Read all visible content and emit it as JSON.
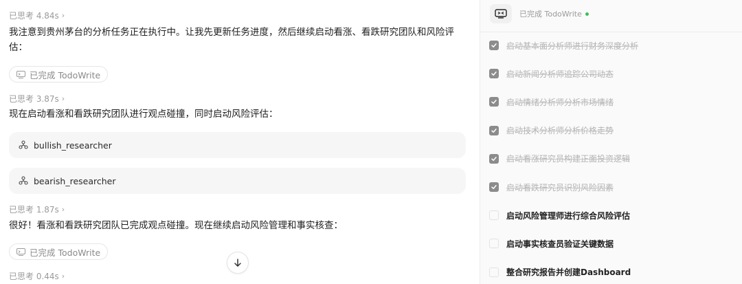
{
  "chat": {
    "think1": "已思考 4.84s",
    "msg1": "我注意到贵州茅台的分析任务正在执行中。让我先更新任务进度，然后继续启动看涨、看跌研究团队和风险评估：",
    "badge1": "已完成 TodoWrite",
    "think2": "已思考 3.87s",
    "msg2": "现在启动看涨和看跌研究团队进行观点碰撞，同时启动风险评估：",
    "tool1": "bullish_researcher",
    "tool2": "bearish_researcher",
    "think3": "已思考 1.87s",
    "msg3": "很好！看涨和看跌研究团队已完成观点碰撞。现在继续启动风险管理和事实核查：",
    "badge2": "已完成 TodoWrite",
    "think4": "已思考 0.44s"
  },
  "panel": {
    "header_label": "已完成 TodoWrite",
    "status_color": "#3cc15a",
    "todos": [
      {
        "text": "启动基本面分析师进行财务深度分析",
        "done": true
      },
      {
        "text": "启动新闻分析师追踪公司动态",
        "done": true
      },
      {
        "text": "启动情绪分析师分析市场情绪",
        "done": true
      },
      {
        "text": "启动技术分析师分析价格走势",
        "done": true
      },
      {
        "text": "启动看涨研究员构建正面投资逻辑",
        "done": true
      },
      {
        "text": "启动看跌研究员识别风险因素",
        "done": true
      },
      {
        "text": "启动风险管理师进行综合风险评估",
        "done": false
      },
      {
        "text": "启动事实核查员验证关键数据",
        "done": false
      },
      {
        "text": "整合研究报告并创建Dashboard",
        "done": false
      }
    ]
  }
}
